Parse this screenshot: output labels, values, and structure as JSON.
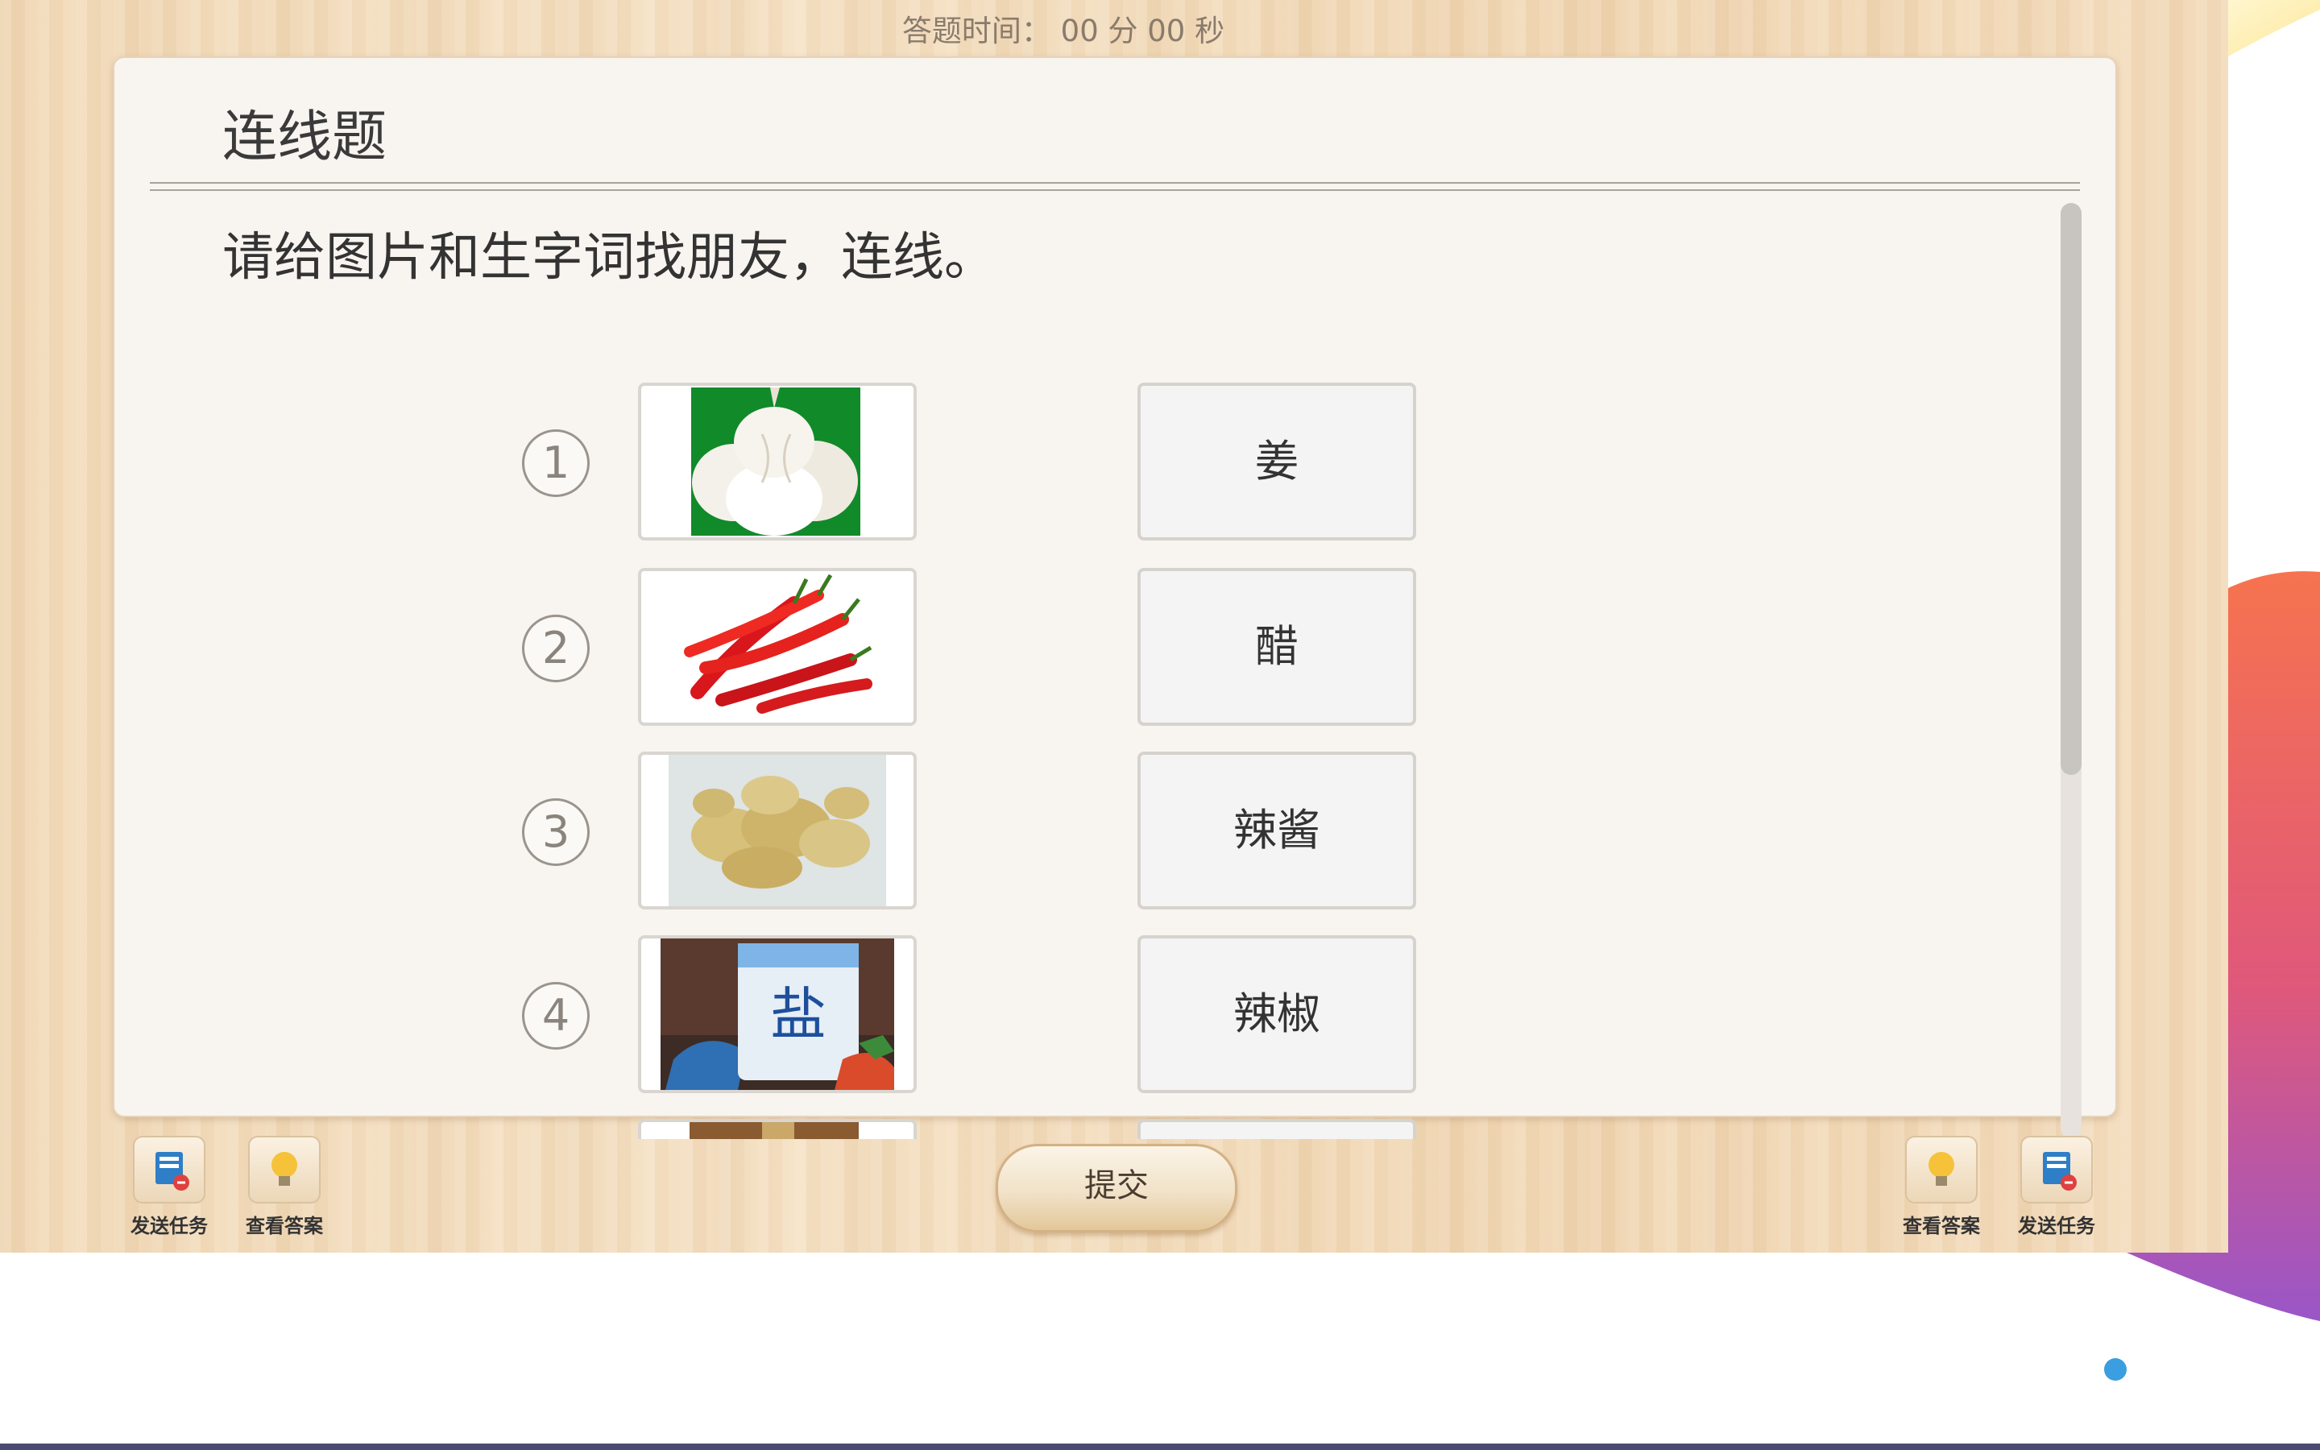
{
  "timer": "答题时间： 00 分 00 秒",
  "panel": {
    "title": "连线题",
    "instruction": "请给图片和生字词找朋友，连线。"
  },
  "items": [
    {
      "number": "1",
      "image": "garlic",
      "word": "姜"
    },
    {
      "number": "2",
      "image": "red-chili-peppers",
      "word": "醋"
    },
    {
      "number": "3",
      "image": "ginger-root",
      "word": "辣酱"
    },
    {
      "number": "4",
      "image": "salt-bag",
      "word": "辣椒"
    }
  ],
  "toolbar": {
    "send_task": "发送任务",
    "view_answer": "查看答案",
    "submit": "提交"
  },
  "colors": {
    "wood": "#f3dcbc",
    "panel_bg": "#f8f4ef",
    "indicator_dot": "#3a9ee0"
  }
}
